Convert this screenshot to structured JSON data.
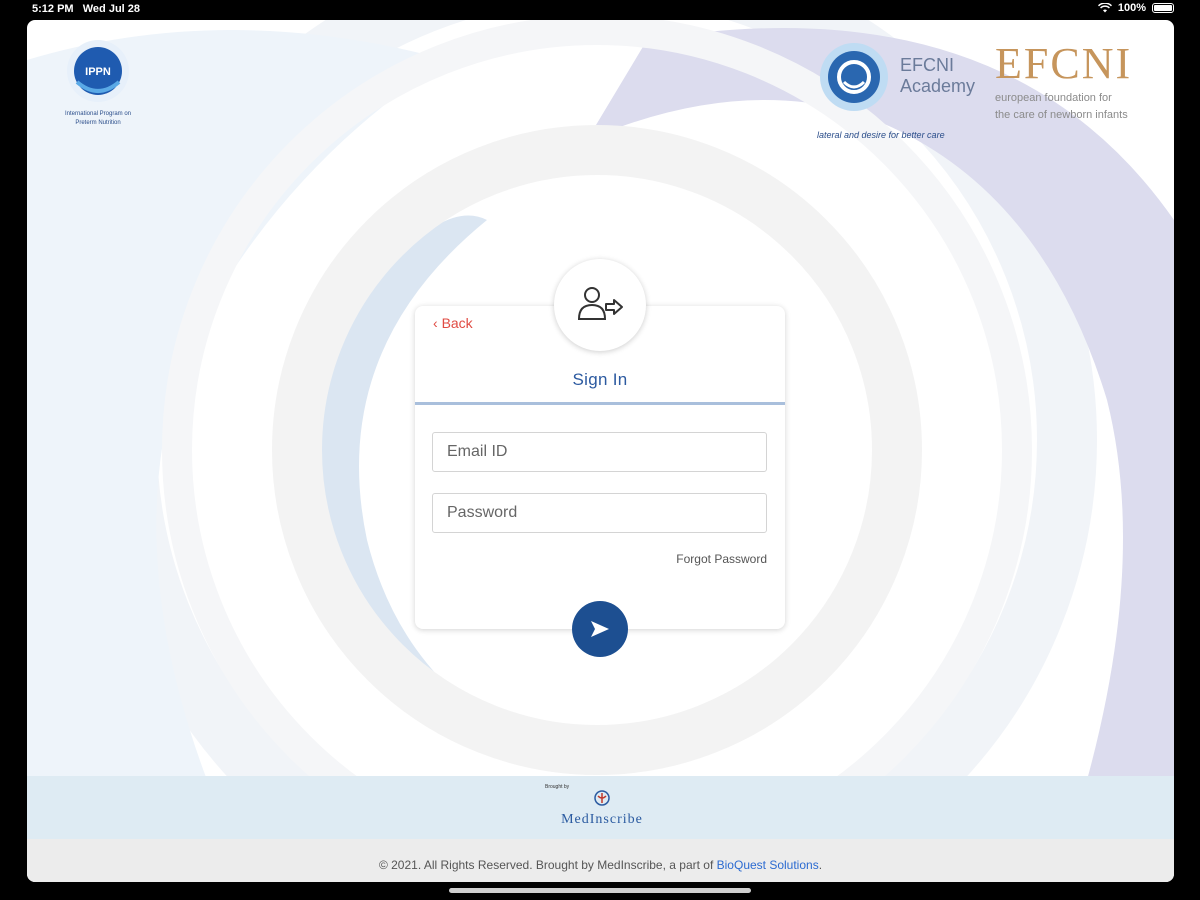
{
  "status_bar": {
    "time": "5:12 PM",
    "date": "Wed Jul 28",
    "battery": "100%",
    "wifi_icon": "wifi-icon"
  },
  "logos": {
    "ippn": {
      "mark": "IPPN",
      "caption_line1": "International Program on",
      "caption_line2": "Preterm Nutrition"
    },
    "efcni_academy": {
      "line1": "EFCNI",
      "line2": "Academy",
      "tagline": "lateral and desire for better care"
    },
    "efcni": {
      "word": "EFCNI",
      "sub_line1": "european foundation for",
      "sub_line2": "the care of newborn infants"
    }
  },
  "card": {
    "back_label": "Back",
    "title": "Sign In",
    "avatar_icon": "user-login-icon",
    "email_placeholder": "Email ID",
    "password_placeholder": "Password",
    "forgot_label": "Forgot Password",
    "submit_icon": "arrow-right-icon"
  },
  "footer": {
    "brought_by": "Brought by",
    "brand": "MedInscribe",
    "copyright": "© 2021. All Rights Reserved. Brought by MedInscribe, a part of ",
    "company_link": "BioQuest Solutions",
    "period": "."
  },
  "colors": {
    "accent": "#1d4f91",
    "title_blue": "#2c5aa0",
    "back_red": "#e04b43",
    "efcni_gold": "#c6955c"
  }
}
